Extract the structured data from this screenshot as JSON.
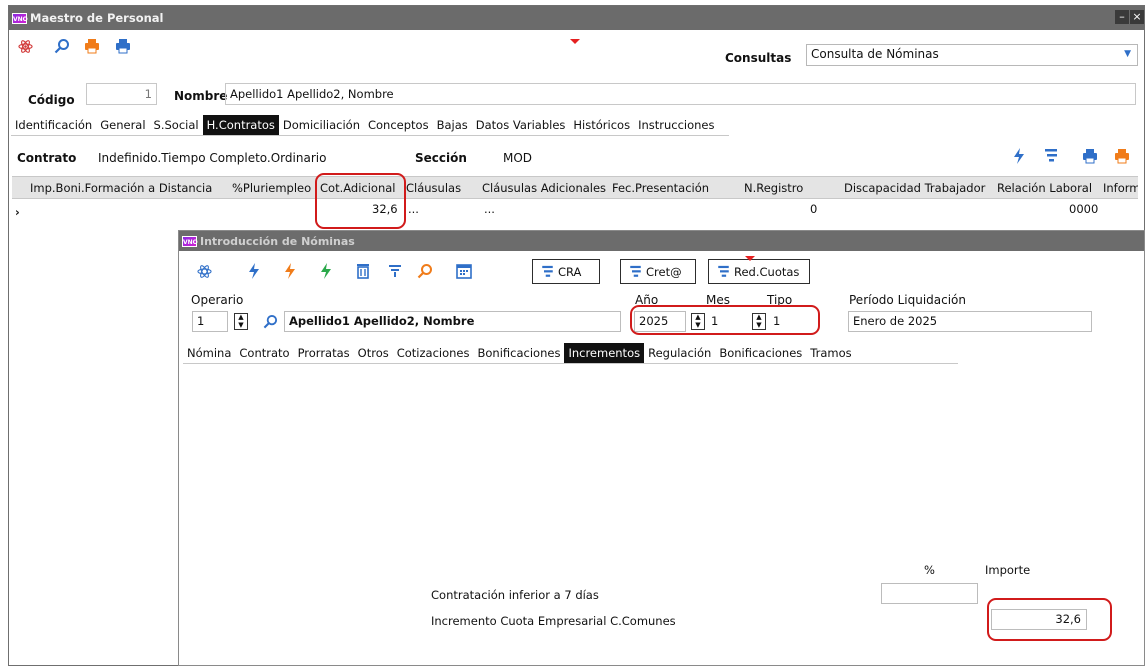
{
  "main_window": {
    "title": "Maestro de Personal",
    "logo_text": "VNO",
    "min_label": "–",
    "close_label": "×",
    "consultas_label": "Consultas",
    "consultas_value": "Consulta de Nóminas",
    "codigo_label": "Código",
    "codigo_value": "1",
    "nombre_label": "Nombre",
    "nombre_value": "Apellido1 Apellido2, Nombre",
    "tabs": [
      "Identificación",
      "General",
      "S.Social",
      "H.Contratos",
      "Domiciliación",
      "Conceptos",
      "Bajas",
      "Datos Variables",
      "Históricos",
      "Instrucciones"
    ],
    "contrato_label": "Contrato",
    "contrato_value": "Indefinido.Tiempo Completo.Ordinario",
    "seccion_label": "Sección",
    "seccion_value": "MOD",
    "grid": {
      "headers": [
        "Imp.Boni.Formación a Distancia",
        "%Pluriempleo",
        "Cot.Adicional",
        "Cláusulas",
        "Cláusulas Adicionales",
        "Fec.Presentación",
        "N.Registro",
        "Discapacidad Trabajador",
        "Relación Laboral",
        "Inform"
      ],
      "row_marker": "›",
      "row": {
        "cot_adicional": "32,6",
        "clausulas": "...",
        "clausulas_adicionales": "...",
        "n_registro": "0",
        "relacion_laboral": "0000"
      }
    }
  },
  "sub_window": {
    "title": "Introducción de Nóminas",
    "logo_text": "VNO",
    "buttons": {
      "cra": "CRA",
      "creta": "Cret@",
      "red_cuotas": "Red.Cuotas"
    },
    "operario_label": "Operario",
    "operario_value": "1",
    "operario_name": "Apellido1 Apellido2, Nombre",
    "anio_label": "Año",
    "anio_value": "2025",
    "mes_label": "Mes",
    "mes_value": "1",
    "tipo_label": "Tipo",
    "tipo_value": "1",
    "periodo_label": "Período Liquidación",
    "periodo_value": "Enero de 2025",
    "tabs": [
      "Nómina",
      "Contrato",
      "Prorratas",
      "Otros",
      "Cotizaciones",
      "Bonificaciones",
      "Incrementos",
      "Regulación",
      "Bonificaciones",
      "Tramos"
    ],
    "incrementos": {
      "pct_header": "%",
      "importe_header": "Importe",
      "row1_label": "Contratación inferior a 7 días",
      "row1_pct": "",
      "row2_label": "Incremento Cuota Empresarial C.Comunes",
      "row2_importe": "32,6"
    }
  },
  "colors": {
    "highlight": "#d11b1b",
    "active_tab": "#111111",
    "titlebar": "#6b6b6b",
    "icon_orange": "#f07c1a",
    "icon_blue": "#2f6fc8",
    "icon_green": "#2aa84a"
  },
  "icons": [
    "atom-icon",
    "search-icon",
    "print-orange-icon",
    "print-blue-icon",
    "lightning-icon",
    "filter-icon",
    "delete-icon",
    "calendar-icon",
    "form-icon"
  ]
}
